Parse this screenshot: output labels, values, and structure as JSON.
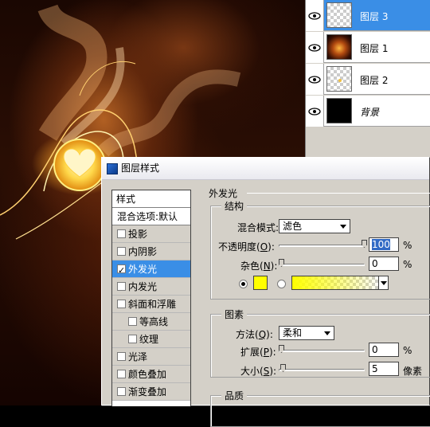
{
  "layers_panel": {
    "layers": [
      {
        "name": "图层 3",
        "selected": true,
        "thumbnail": "transparent-checker"
      },
      {
        "name": "图层 1",
        "selected": false,
        "thumbnail": "fire-image"
      },
      {
        "name": "图层 2",
        "selected": false,
        "thumbnail": "transparent-checker-dot"
      },
      {
        "name": "背景",
        "selected": false,
        "thumbnail": "black",
        "italic": true
      }
    ],
    "eye_icon": "eye-icon"
  },
  "dialog": {
    "title": "图层样式",
    "styles_list": {
      "header": "样式",
      "blend_options": "混合选项:默认",
      "items": [
        {
          "label": "投影",
          "checked": false
        },
        {
          "label": "内阴影",
          "checked": false
        },
        {
          "label": "外发光",
          "checked": true,
          "selected": true
        },
        {
          "label": "内发光",
          "checked": false
        },
        {
          "label": "斜面和浮雕",
          "checked": false
        },
        {
          "label": "等高线",
          "checked": false,
          "indent": true
        },
        {
          "label": "纹理",
          "checked": false,
          "indent": true
        },
        {
          "label": "光泽",
          "checked": false
        },
        {
          "label": "颜色叠加",
          "checked": false
        },
        {
          "label": "渐变叠加",
          "checked": false
        }
      ]
    },
    "outer_glow": {
      "title": "外发光",
      "structure": {
        "title": "结构",
        "blend_mode_label": "混合模式:",
        "blend_mode_value": "滤色",
        "opacity_label_pre": "不透明度(",
        "opacity_label_key": "O",
        "opacity_label_post": "):",
        "opacity_value": "100",
        "opacity_unit": "%",
        "opacity_level": 1.0,
        "noise_label_pre": "杂色(",
        "noise_label_key": "N",
        "noise_label_post": "):",
        "noise_value": "0",
        "noise_unit": "%",
        "noise_level": 0.0,
        "solid_color": "#ffff00",
        "gradient_from": "#ffff00",
        "color_mode_selected": "solid"
      },
      "elements": {
        "title": "图素",
        "technique_label_pre": "方法(",
        "technique_label_key": "Q",
        "technique_label_post": "):",
        "technique_value": "柔和",
        "spread_label_pre": "扩展(",
        "spread_label_key": "P",
        "spread_label_post": "):",
        "spread_value": "0",
        "spread_unit": "%",
        "spread_level": 0.0,
        "size_label_pre": "大小(",
        "size_label_key": "S",
        "size_label_post": "):",
        "size_value": "5",
        "size_unit": "像素",
        "size_level": 0.02
      },
      "quality": {
        "title": "品质"
      }
    }
  }
}
